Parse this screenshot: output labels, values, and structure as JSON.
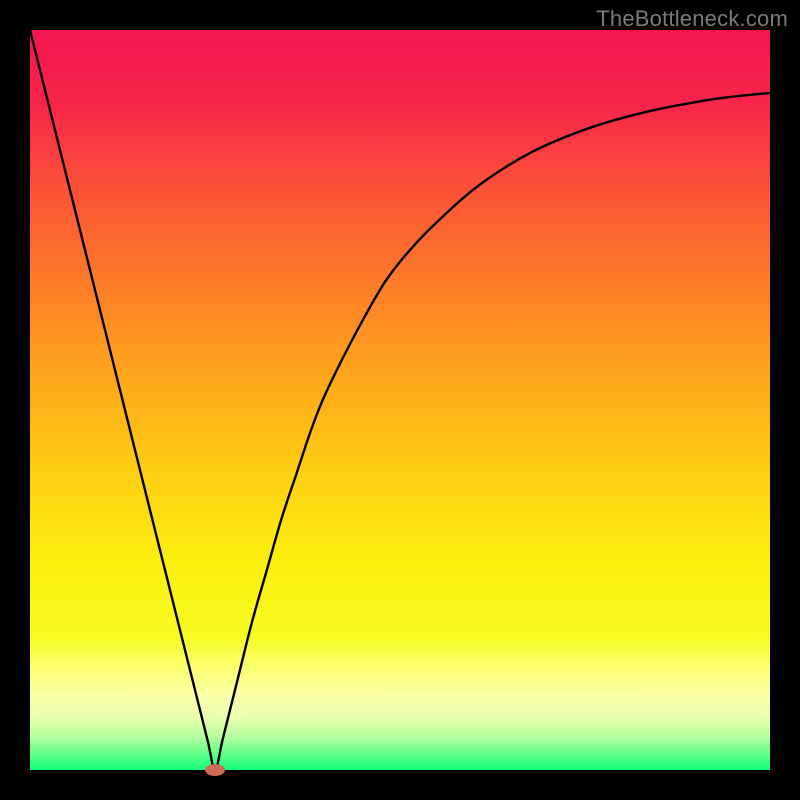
{
  "watermark": "TheBottleneck.com",
  "chart_data": {
    "type": "line",
    "title": "",
    "xlabel": "",
    "ylabel": "",
    "xlim": [
      0,
      100
    ],
    "ylim": [
      0,
      100
    ],
    "series": [
      {
        "name": "curve",
        "x": [
          0,
          2,
          4,
          6,
          8,
          10,
          12,
          14,
          16,
          18,
          20,
          22,
          24,
          25,
          26,
          27,
          28,
          30,
          32,
          34,
          36,
          38,
          40,
          44,
          48,
          52,
          56,
          60,
          64,
          68,
          72,
          76,
          80,
          84,
          88,
          92,
          96,
          100
        ],
        "values": [
          100,
          92,
          84,
          76,
          68,
          60,
          52,
          44,
          36,
          28,
          20,
          12,
          4,
          0,
          4,
          8,
          12,
          20,
          27,
          34,
          40,
          46,
          51,
          59,
          66,
          71,
          75,
          78.5,
          81.3,
          83.6,
          85.4,
          86.9,
          88.1,
          89.1,
          89.9,
          90.6,
          91.1,
          91.5
        ]
      }
    ],
    "marker": {
      "x": 25,
      "y": 0,
      "color": "#cf6a58",
      "rx": 10,
      "ry": 6
    },
    "background_gradient": {
      "stops": [
        {
          "offset": 0.0,
          "color": "#f3154f"
        },
        {
          "offset": 0.1,
          "color": "#f6254a"
        },
        {
          "offset": 0.22,
          "color": "#fb5436"
        },
        {
          "offset": 0.35,
          "color": "#fd7f27"
        },
        {
          "offset": 0.48,
          "color": "#fea91b"
        },
        {
          "offset": 0.6,
          "color": "#fecf12"
        },
        {
          "offset": 0.72,
          "color": "#fcf00f"
        },
        {
          "offset": 0.82,
          "color": "#f7fb21"
        },
        {
          "offset": 0.86,
          "color": "#fbff6e"
        },
        {
          "offset": 0.9,
          "color": "#fdffa8"
        },
        {
          "offset": 0.93,
          "color": "#e7ffb0"
        },
        {
          "offset": 0.955,
          "color": "#b6ff9f"
        },
        {
          "offset": 0.975,
          "color": "#6dff8a"
        },
        {
          "offset": 1.0,
          "color": "#13ff79"
        }
      ]
    }
  }
}
